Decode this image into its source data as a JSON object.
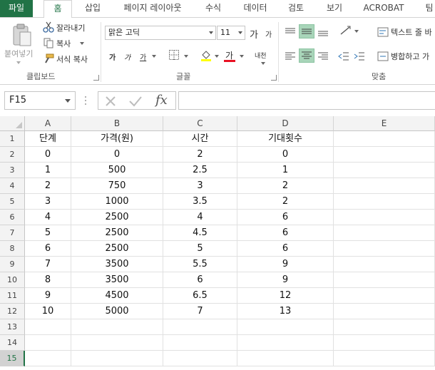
{
  "tabs": [
    {
      "label": "파일",
      "type": "file"
    },
    {
      "label": "홈",
      "type": "active"
    },
    {
      "label": "삽입",
      "type": ""
    },
    {
      "label": "페이지 레이아웃",
      "type": ""
    },
    {
      "label": "수식",
      "type": ""
    },
    {
      "label": "데이터",
      "type": ""
    },
    {
      "label": "검토",
      "type": ""
    },
    {
      "label": "보기",
      "type": ""
    },
    {
      "label": "ACROBAT",
      "type": ""
    },
    {
      "label": "팀",
      "type": ""
    }
  ],
  "clipboard": {
    "paste_label": "붙여넣기",
    "cut_label": "잘라내기",
    "copy_label": "복사",
    "format_painter_label": "서식 복사",
    "group_label": "클립보드"
  },
  "font": {
    "font_name": "맑은 고딕",
    "font_size": "11",
    "grow_label": "가",
    "shrink_label": "가",
    "bold_label": "가",
    "italic_label": "가",
    "underline_label": "가",
    "font_color_label": "가",
    "phonetic_label": "내천",
    "group_label": "글꼴"
  },
  "alignment": {
    "wrap_text_label": "텍스트 줄 바",
    "merge_label": "병합하고 가",
    "group_label": "맞춤"
  },
  "formula_bar": {
    "name_box": "F15",
    "fx_label": "fx",
    "formula": ""
  },
  "colors": {
    "excel_green": "#217346",
    "selected_button": "#a8d5b9",
    "font_color_bar": "#e81123"
  },
  "columns": [
    "A",
    "B",
    "C",
    "D",
    "E"
  ],
  "rows": [
    "1",
    "2",
    "3",
    "4",
    "5",
    "6",
    "7",
    "8",
    "9",
    "10",
    "11",
    "12",
    "13",
    "14",
    "15"
  ],
  "selected_row": "15",
  "cells": [
    [
      "단계",
      "가격(원)",
      "시간",
      "기대횟수",
      ""
    ],
    [
      "0",
      "0",
      "2",
      "0",
      ""
    ],
    [
      "1",
      "500",
      "2.5",
      "1",
      ""
    ],
    [
      "2",
      "750",
      "3",
      "2",
      ""
    ],
    [
      "3",
      "1000",
      "3.5",
      "2",
      ""
    ],
    [
      "4",
      "2500",
      "4",
      "6",
      ""
    ],
    [
      "5",
      "2500",
      "4.5",
      "6",
      ""
    ],
    [
      "6",
      "2500",
      "5",
      "6",
      ""
    ],
    [
      "7",
      "3500",
      "5.5",
      "9",
      ""
    ],
    [
      "8",
      "3500",
      "6",
      "9",
      ""
    ],
    [
      "9",
      "4500",
      "6.5",
      "12",
      ""
    ],
    [
      "10",
      "5000",
      "7",
      "13",
      ""
    ],
    [
      "",
      "",
      "",
      "",
      ""
    ],
    [
      "",
      "",
      "",
      "",
      ""
    ],
    [
      "",
      "",
      "",
      "",
      ""
    ]
  ]
}
